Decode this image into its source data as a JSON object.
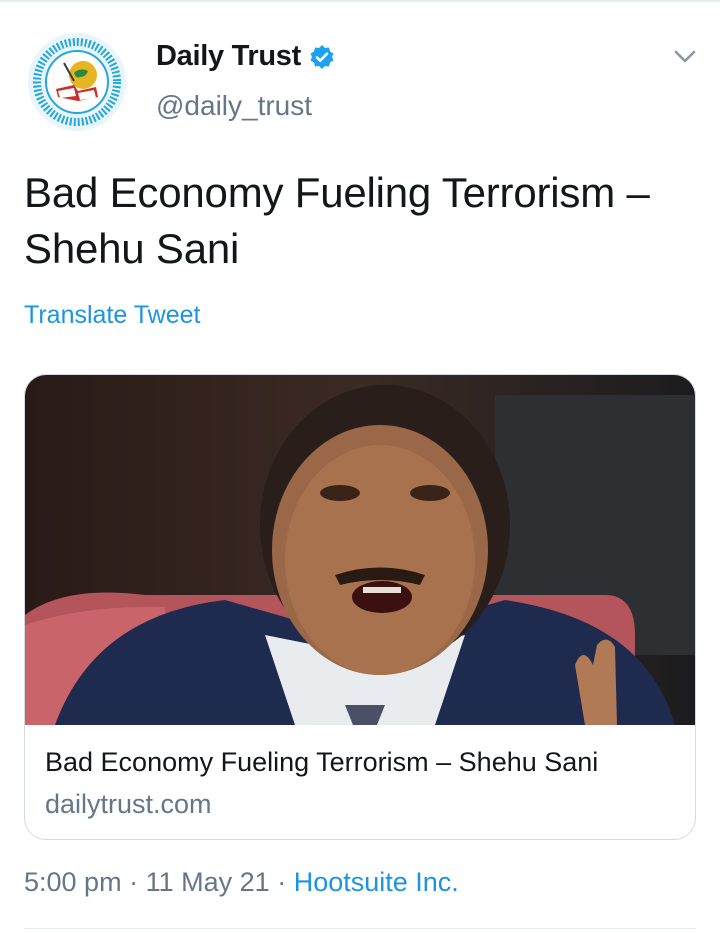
{
  "account": {
    "display_name": "Daily Trust",
    "handle": "@daily_trust",
    "verified": true
  },
  "tweet": {
    "text_line1": "Bad Economy Fueling Terrorism –",
    "text_line2": "Shehu Sani",
    "translate_label": "Translate Tweet"
  },
  "link_card": {
    "title": "Bad Economy Fueling Terrorism – Shehu Sani",
    "domain": "dailytrust.com"
  },
  "meta": {
    "time": "5:00 pm",
    "separator": "·",
    "date": "11 May 21",
    "source": "Hootsuite Inc."
  },
  "icons": {
    "verified": "verified-badge-icon",
    "more": "chevron-down-icon"
  },
  "colors": {
    "link_blue": "#1b95e0",
    "secondary_text": "#657786",
    "primary_text": "#14171a",
    "border": "#d4dbe0"
  }
}
